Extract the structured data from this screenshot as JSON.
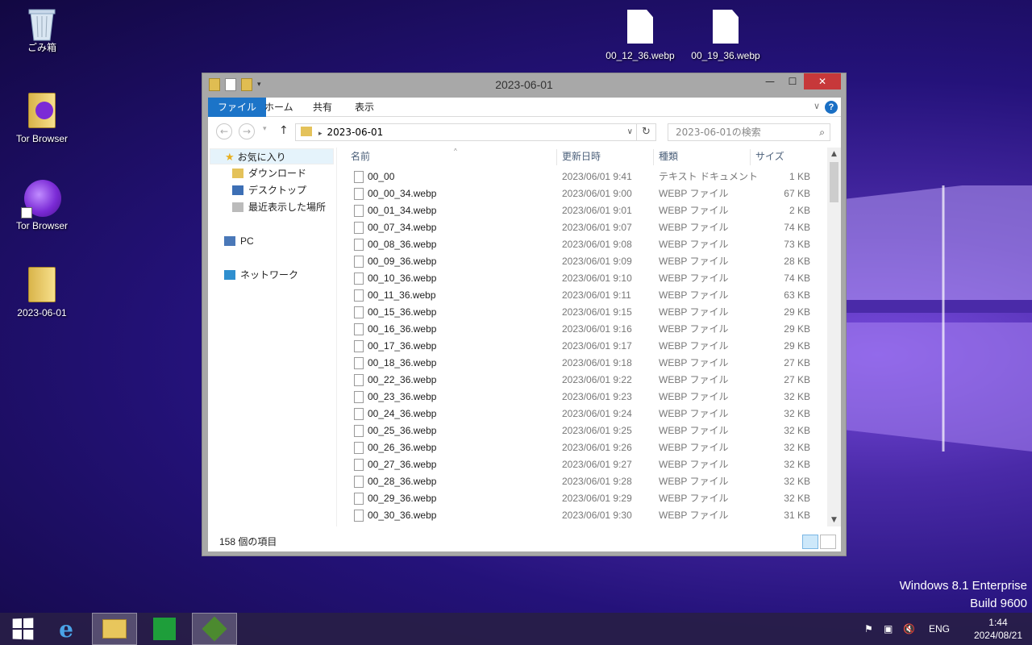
{
  "desktop": {
    "icons": [
      {
        "label": "ごみ箱"
      },
      {
        "label": "Tor Browser"
      },
      {
        "label": "Tor Browser"
      },
      {
        "label": "2023-06-01"
      },
      {
        "label": "00_12_36.webp"
      },
      {
        "label": "00_19_36.webp"
      }
    ],
    "watermark": {
      "line1": "Windows 8.1 Enterprise",
      "line2": "Build 9600"
    }
  },
  "window": {
    "title": "2023-06-01",
    "ribbon_tabs": [
      "ファイル",
      "ホーム",
      "共有",
      "表示"
    ],
    "help_label": "?",
    "address": "2023-06-01",
    "search_placeholder": "2023-06-01の検索",
    "nav": {
      "favorites": "お気に入り",
      "downloads": "ダウンロード",
      "desktop": "デスクトップ",
      "recent": "最近表示した場所",
      "pc": "PC",
      "network": "ネットワーク"
    },
    "columns": [
      "名前",
      "更新日時",
      "種類",
      "サイズ"
    ],
    "files": [
      {
        "name": "00_00",
        "date": "2023/06/01 9:41",
        "type": "テキスト ドキュメント",
        "size": "1 KB"
      },
      {
        "name": "00_00_34.webp",
        "date": "2023/06/01 9:00",
        "type": "WEBP ファイル",
        "size": "67 KB"
      },
      {
        "name": "00_01_34.webp",
        "date": "2023/06/01 9:01",
        "type": "WEBP ファイル",
        "size": "2 KB"
      },
      {
        "name": "00_07_34.webp",
        "date": "2023/06/01 9:07",
        "type": "WEBP ファイル",
        "size": "74 KB"
      },
      {
        "name": "00_08_36.webp",
        "date": "2023/06/01 9:08",
        "type": "WEBP ファイル",
        "size": "73 KB"
      },
      {
        "name": "00_09_36.webp",
        "date": "2023/06/01 9:09",
        "type": "WEBP ファイル",
        "size": "28 KB"
      },
      {
        "name": "00_10_36.webp",
        "date": "2023/06/01 9:10",
        "type": "WEBP ファイル",
        "size": "74 KB"
      },
      {
        "name": "00_11_36.webp",
        "date": "2023/06/01 9:11",
        "type": "WEBP ファイル",
        "size": "63 KB"
      },
      {
        "name": "00_15_36.webp",
        "date": "2023/06/01 9:15",
        "type": "WEBP ファイル",
        "size": "29 KB"
      },
      {
        "name": "00_16_36.webp",
        "date": "2023/06/01 9:16",
        "type": "WEBP ファイル",
        "size": "29 KB"
      },
      {
        "name": "00_17_36.webp",
        "date": "2023/06/01 9:17",
        "type": "WEBP ファイル",
        "size": "29 KB"
      },
      {
        "name": "00_18_36.webp",
        "date": "2023/06/01 9:18",
        "type": "WEBP ファイル",
        "size": "27 KB"
      },
      {
        "name": "00_22_36.webp",
        "date": "2023/06/01 9:22",
        "type": "WEBP ファイル",
        "size": "27 KB"
      },
      {
        "name": "00_23_36.webp",
        "date": "2023/06/01 9:23",
        "type": "WEBP ファイル",
        "size": "32 KB"
      },
      {
        "name": "00_24_36.webp",
        "date": "2023/06/01 9:24",
        "type": "WEBP ファイル",
        "size": "32 KB"
      },
      {
        "name": "00_25_36.webp",
        "date": "2023/06/01 9:25",
        "type": "WEBP ファイル",
        "size": "32 KB"
      },
      {
        "name": "00_26_36.webp",
        "date": "2023/06/01 9:26",
        "type": "WEBP ファイル",
        "size": "32 KB"
      },
      {
        "name": "00_27_36.webp",
        "date": "2023/06/01 9:27",
        "type": "WEBP ファイル",
        "size": "32 KB"
      },
      {
        "name": "00_28_36.webp",
        "date": "2023/06/01 9:28",
        "type": "WEBP ファイル",
        "size": "32 KB"
      },
      {
        "name": "00_29_36.webp",
        "date": "2023/06/01 9:29",
        "type": "WEBP ファイル",
        "size": "32 KB"
      },
      {
        "name": "00_30_36.webp",
        "date": "2023/06/01 9:30",
        "type": "WEBP ファイル",
        "size": "31 KB"
      }
    ],
    "status": "158 個の項目"
  },
  "taskbar": {
    "language": "ENG",
    "time": "1:44",
    "date": "2024/08/21"
  },
  "colors": {
    "accent": "#1c74c8",
    "close_button": "#c7383a",
    "desktop_bg": "#24127a"
  }
}
